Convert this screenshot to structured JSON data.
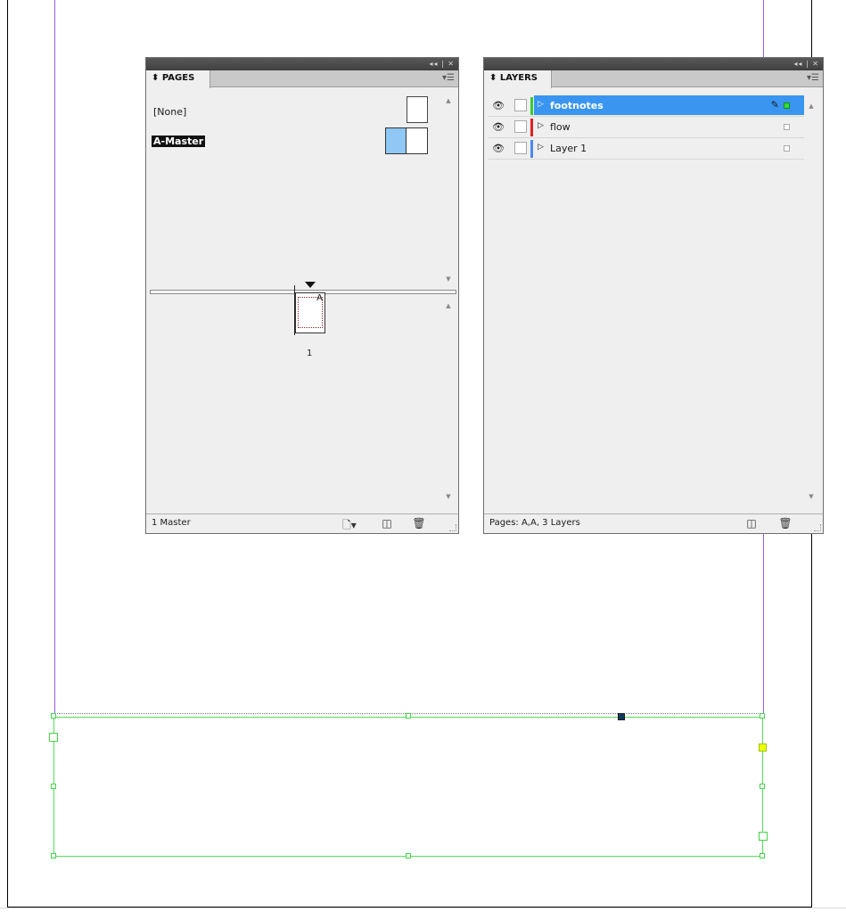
{
  "colors": {
    "guide": "#9a5cf0",
    "frame": "#55e05a",
    "selection": "#3a95f0",
    "footnotes_layer": "#33cc33",
    "flow_layer": "#e02020",
    "layer1_layer": "#4a8af0"
  },
  "pages_panel": {
    "tab_label": "PAGES",
    "collapse_icon": "double-chevron-left-icon",
    "close_icon": "close-icon",
    "menu_icon": "panel-menu-icon",
    "masters": [
      {
        "label": "[None]"
      },
      {
        "label": "A-Master"
      }
    ],
    "page_prefix": "A",
    "page_number": "1",
    "footer_text": "1 Master",
    "footer_buttons": [
      "edit-page-size-icon",
      "new-page-icon",
      "trash-icon"
    ]
  },
  "layers_panel": {
    "tab_label": "LAYERS",
    "layers": [
      {
        "name": "footnotes",
        "selected": true,
        "color": "#33cc33"
      },
      {
        "name": "flow",
        "selected": false,
        "color": "#e02020"
      },
      {
        "name": "Layer 1",
        "selected": false,
        "color": "#4a8af0"
      }
    ],
    "footer_text": "Pages: A,A, 3 Layers",
    "footer_buttons": [
      "new-layer-icon",
      "trash-icon"
    ]
  }
}
